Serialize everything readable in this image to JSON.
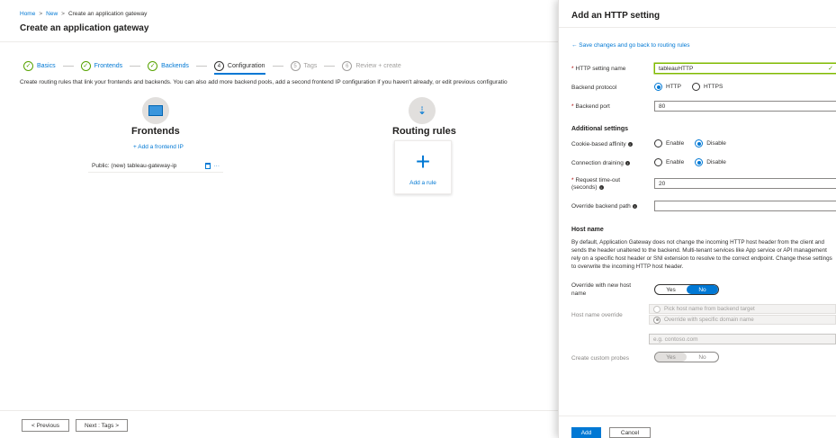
{
  "breadcrumb": {
    "home": "Home",
    "sep": ">",
    "new": "New",
    "current": "Create an application gateway"
  },
  "page_title": "Create an application gateway",
  "steps": {
    "basics": {
      "check": "✓",
      "label": "Basics"
    },
    "frontends": {
      "check": "✓",
      "label": "Frontends"
    },
    "backends": {
      "check": "✓",
      "label": "Backends"
    },
    "configuration": {
      "num": "4",
      "label": "Configuration"
    },
    "tags": {
      "num": "5",
      "label": "Tags"
    },
    "review": {
      "num": "6",
      "label": "Review + create"
    }
  },
  "intro": "Create routing rules that link your frontends and backends. You can also add more backend pools, add a second frontend IP configuration if you haven't already, or edit previous configuratio",
  "frontends": {
    "title": "Frontends",
    "add_link": "+ Add a frontend IP",
    "row_label": "Public: (new) tableau-gateway-ip",
    "more": "···"
  },
  "routing": {
    "title": "Routing rules",
    "add_plus": "+",
    "add_label": "Add a rule"
  },
  "nav": {
    "previous": "< Previous",
    "next": "Next : Tags >"
  },
  "panel": {
    "title": "Add an HTTP setting",
    "back_link": "← Save changes and go back to routing rules",
    "required_mark": "*",
    "http_setting_name_label": "HTTP setting name",
    "http_setting_name_value": "tableauHTTP",
    "valid_mark": "✓",
    "backend_protocol_label": "Backend protocol",
    "protocol_http": "HTTP",
    "protocol_https": "HTTPS",
    "backend_port_label": "Backend port",
    "backend_port_value": "80",
    "additional_settings": "Additional settings",
    "cookie_affinity_label": "Cookie-based affinity",
    "enable": "Enable",
    "disable": "Disable",
    "connection_draining_label": "Connection draining",
    "timeout_label_1": "Request time-out",
    "timeout_label_2": "(seconds)",
    "timeout_value": "20",
    "override_path_label": "Override backend path",
    "override_path_value": "",
    "info_glyph": "i",
    "host_name_heading": "Host name",
    "host_name_desc": "By default, Application Gateway does not change the incoming HTTP host header from the client and sends the header unaltered to the backend. Multi-tenant services like App service or API management rely on a specific host header or SNI extension to resolve to the correct endpoint. Change these settings to overwrite the incoming HTTP host header.",
    "override_host_label_1": "Override with new host",
    "override_host_label_2": "name",
    "yes": "Yes",
    "no": "No",
    "host_override_label": "Host name override",
    "pick_host_option": "Pick host name from backend target",
    "override_domain_option": "Override with specific domain name",
    "domain_placeholder": "e.g. contoso.com",
    "custom_probes_label": "Create custom probes",
    "add_button": "Add",
    "cancel_button": "Cancel"
  },
  "colors": {
    "accent": "#0078d4",
    "success": "#57a300",
    "required": "#a80000"
  }
}
